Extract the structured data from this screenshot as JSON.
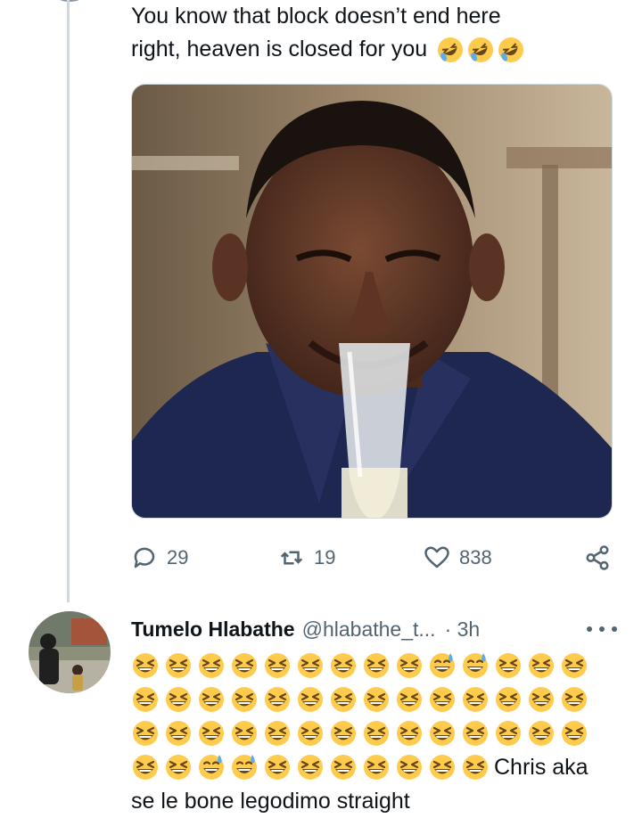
{
  "tweet": {
    "text_line1": "You know that block doesn’t end here",
    "text_line2": "right, heaven is closed for you",
    "text_emojis": [
      "rolling-on-floor-laughing",
      "rolling-on-floor-laughing",
      "rolling-on-floor-laughing"
    ],
    "photo_description_icon": "man-drinking-champagne-photo",
    "actions": {
      "reply_count": "29",
      "retweet_count": "19",
      "like_count": "838"
    }
  },
  "reply": {
    "name": "Tumelo Hlabathe",
    "handle": "@hlabathe_t...",
    "time": "· 3h",
    "emoji_rows": [
      [
        "grin-squint",
        "grin-squint",
        "grin-squint",
        "grin-squint",
        "grin-squint",
        "grin-squint",
        "grin-squint",
        "grin-squint",
        "grin-squint",
        "grin-sweat",
        "grin-sweat",
        "grin-squint",
        "grin-squint",
        "grin-squint"
      ],
      [
        "grin-squint",
        "grin-squint",
        "grin-squint",
        "grin-squint",
        "grin-squint",
        "grin-squint",
        "grin-squint",
        "grin-squint",
        "grin-squint",
        "grin-squint",
        "grin-squint",
        "grin-squint",
        "grin-squint",
        "grin-squint"
      ],
      [
        "grin-squint",
        "grin-squint",
        "grin-squint",
        "grin-squint",
        "grin-squint",
        "grin-squint",
        "grin-squint",
        "grin-squint",
        "grin-squint",
        "grin-squint",
        "grin-squint",
        "grin-squint",
        "grin-squint",
        "grin-squint"
      ],
      [
        "grin-squint",
        "grin-squint",
        "grin-sweat",
        "grin-sweat",
        "grin-squint",
        "grin-squint",
        "grin-squint",
        "grin-squint",
        "grin-squint",
        "grin-squint",
        "grin-squint"
      ]
    ],
    "text_after_emojis": "Chris aka",
    "text_line_last": "se le bone legodimo straight"
  },
  "colors": {
    "text": "#0f1419",
    "secondary": "#536471",
    "thread_line": "#cfd9de",
    "emoji_yellow": "#ffcb4c"
  }
}
